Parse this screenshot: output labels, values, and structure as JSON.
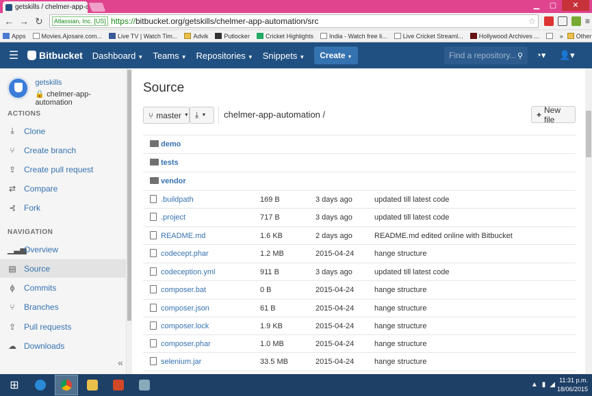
{
  "browser": {
    "tab_title": "getskills / chelmer-app-a",
    "tab_close": "×",
    "window_buttons": [
      "▁",
      "▢",
      "✕"
    ],
    "secure_label": "Atlassian, Inc. [US]",
    "url_scheme": "https://",
    "url_rest": "bitbucket.org/getskills/chelmer-app-automation/src",
    "bookmarks": [
      "Apps",
      "Movies.Ajosare.com...",
      "Live TV | Watch Tim...",
      "Advik",
      "Putlocker",
      "Cricket Highlights",
      "India - Watch free li...",
      "Live Cricket Streaml...",
      "Hollywood Archives ..."
    ],
    "bookmarks_overflow": "»",
    "other_bookmarks": "Other bookmarks"
  },
  "header": {
    "brand": "Bitbucket",
    "nav": [
      "Dashboard",
      "Teams",
      "Repositories",
      "Snippets"
    ],
    "create_label": "Create",
    "search_placeholder": "Find a repository..."
  },
  "sidebar": {
    "owner": "getskills",
    "repo": "chelmer-app-automation",
    "actions_title": "ACTIONS",
    "actions": [
      {
        "label": "Clone",
        "icon": "clone-icon"
      },
      {
        "label": "Create branch",
        "icon": "branch-icon"
      },
      {
        "label": "Create pull request",
        "icon": "pull-request-icon"
      },
      {
        "label": "Compare",
        "icon": "compare-icon"
      },
      {
        "label": "Fork",
        "icon": "fork-icon"
      }
    ],
    "navigation_title": "NAVIGATION",
    "navigation": [
      {
        "label": "Overview",
        "icon": "overview-icon"
      },
      {
        "label": "Source",
        "icon": "source-icon",
        "active": true
      },
      {
        "label": "Commits",
        "icon": "commits-icon"
      },
      {
        "label": "Branches",
        "icon": "branches-icon"
      },
      {
        "label": "Pull requests",
        "icon": "pull-requests-icon"
      },
      {
        "label": "Downloads",
        "icon": "downloads-icon"
      }
    ],
    "collapse": "«"
  },
  "main": {
    "title": "Source",
    "branch": "master",
    "breadcrumb": "chelmer-app-automation /",
    "new_file": "New file",
    "folders": [
      "demo",
      "tests",
      "vendor"
    ],
    "files": [
      {
        "name": ".buildpath",
        "size": "169 B",
        "age": "3 days ago",
        "message": "updated till latest code"
      },
      {
        "name": ".project",
        "size": "717 B",
        "age": "3 days ago",
        "message": "updated till latest code"
      },
      {
        "name": "README.md",
        "size": "1.6 KB",
        "age": "2 days ago",
        "message": "README.md edited online with Bitbucket"
      },
      {
        "name": "codecept.phar",
        "size": "1.2 MB",
        "age": "2015-04-24",
        "message": "hange structure"
      },
      {
        "name": "codeception.yml",
        "size": "911 B",
        "age": "3 days ago",
        "message": "updated till latest code"
      },
      {
        "name": "composer.bat",
        "size": "0 B",
        "age": "2015-04-24",
        "message": "hange structure"
      },
      {
        "name": "composer.json",
        "size": "61 B",
        "age": "2015-04-24",
        "message": "hange structure"
      },
      {
        "name": "composer.lock",
        "size": "1.9 KB",
        "age": "2015-04-24",
        "message": "hange structure"
      },
      {
        "name": "composer.phar",
        "size": "1.0 MB",
        "age": "2015-04-24",
        "message": "hange structure"
      },
      {
        "name": "selenium.jar",
        "size": "33.5 MB",
        "age": "2015-04-24",
        "message": "hange structure"
      }
    ]
  },
  "taskbar": {
    "time": "11:31 p.m.",
    "date": "18/06/2015"
  }
}
